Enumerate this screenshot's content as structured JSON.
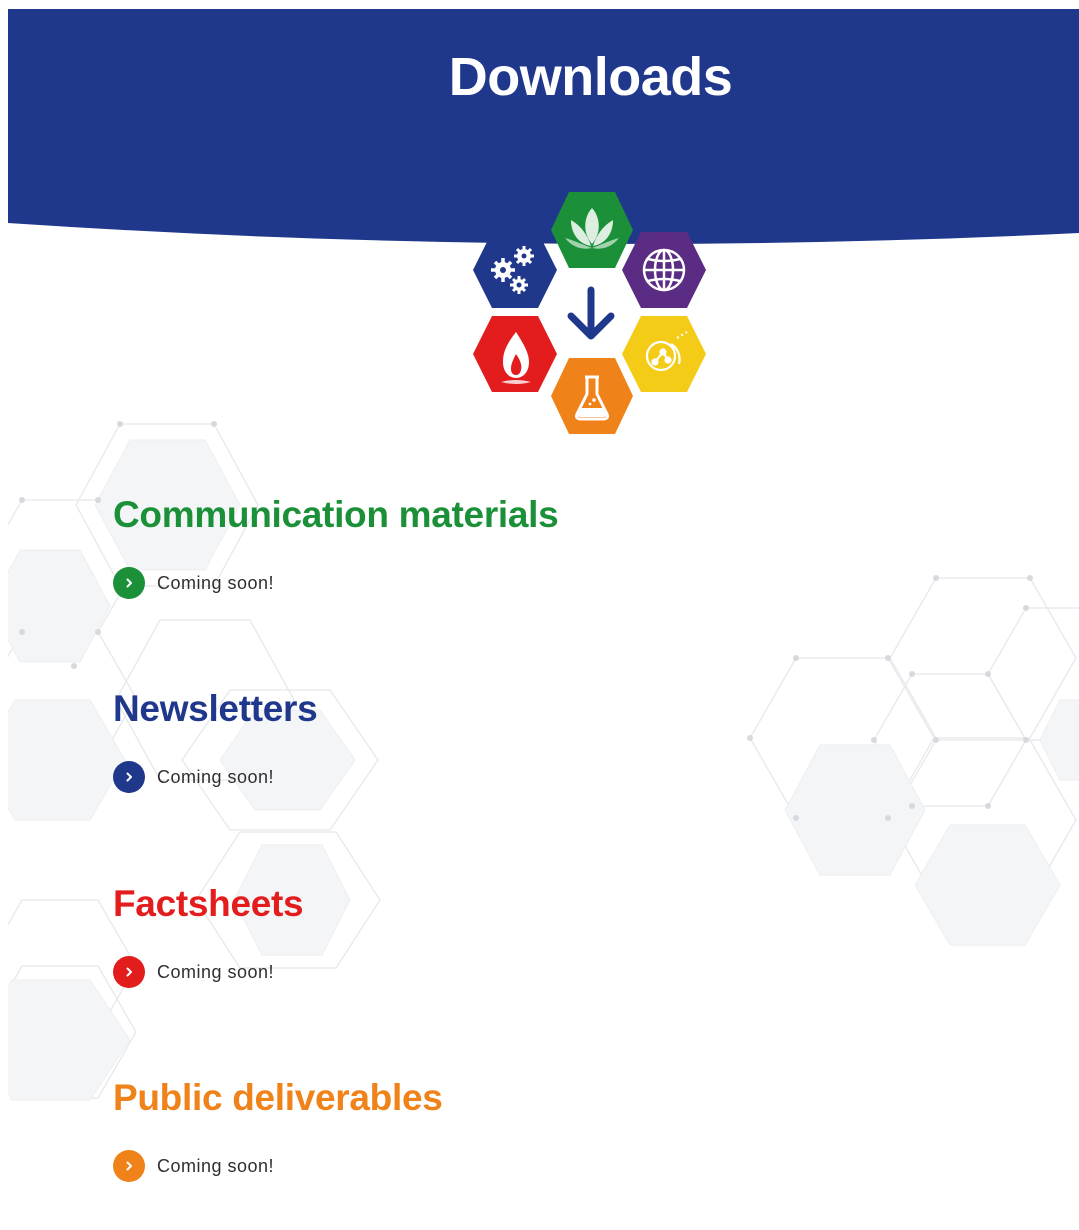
{
  "page": {
    "title": "Downloads"
  },
  "colors": {
    "header_blue": "#20388c",
    "green": "#1b9039",
    "blue": "#20388c",
    "red": "#e31d1d",
    "orange": "#f0821a",
    "yellow": "#f4cb16",
    "purple": "#5b2c83"
  },
  "logo": {
    "hexagons": [
      {
        "icon": "gears-icon",
        "color": "#20388c"
      },
      {
        "icon": "lotus-icon",
        "color": "#1b9039"
      },
      {
        "icon": "globe-icon",
        "color": "#5b2c83"
      },
      {
        "icon": "flame-icon",
        "color": "#e31d1d"
      },
      {
        "icon": "molecule-icon",
        "color": "#f4cb16"
      },
      {
        "icon": "flask-icon",
        "color": "#f0821a"
      }
    ],
    "center_icon": "arrow-down-icon"
  },
  "sections": [
    {
      "title": "Communication materials",
      "color": "#1b9039",
      "item_label": "Coming soon!",
      "icon": "chevron-right-icon"
    },
    {
      "title": "Newsletters",
      "color": "#20388c",
      "item_label": "Coming soon!",
      "icon": "chevron-right-icon"
    },
    {
      "title": "Factsheets",
      "color": "#e31d1d",
      "item_label": "Coming soon!",
      "icon": "chevron-right-icon"
    },
    {
      "title": "Public deliverables",
      "color": "#f0821a",
      "item_label": "Coming soon!",
      "icon": "chevron-right-icon"
    }
  ]
}
